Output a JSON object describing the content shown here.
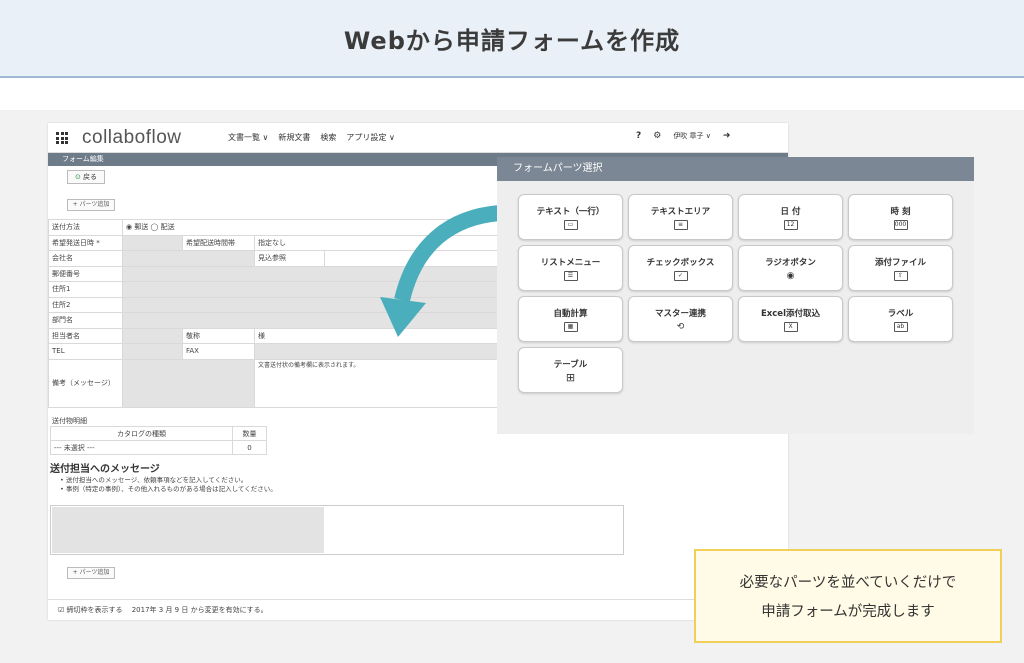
{
  "banner": {
    "title": "Webから申請フォームを作成"
  },
  "app": {
    "logo": "collaboflow",
    "nav": [
      "文書一覧 ∨",
      "新規文書",
      "検索",
      "アプリ設定 ∨"
    ],
    "help": "?",
    "user": "伊吹 章子 ∨",
    "subbar": "フォーム編集",
    "back_button": "戻る",
    "add_parts": "+ パーツ追加",
    "form_rows": [
      {
        "label": "送付方法",
        "value": "◉ 郵送 ◯ 配送"
      },
      {
        "label": "希望発送日時 *",
        "value": "",
        "extra1": "希望配送時間帯",
        "extra2": "指定なし"
      },
      {
        "label": "会社名",
        "value": "",
        "extra1": "見込参照"
      },
      {
        "label": "郵便番号",
        "value": ""
      },
      {
        "label": "住所1",
        "value": ""
      },
      {
        "label": "住所2",
        "value": ""
      },
      {
        "label": "部門名",
        "value": ""
      },
      {
        "label": "担当者名",
        "value": "",
        "extra1": "敬称",
        "extra2": "様"
      },
      {
        "label": "TEL",
        "value": "",
        "extra1": "FAX"
      },
      {
        "label": "備考（メッセージ）",
        "value": "",
        "note": "文書送付状の備考欄に表示されます。"
      }
    ],
    "catalog_section": "送付物明細",
    "catalog_headers": [
      "カタログの種類",
      "数量"
    ],
    "catalog_row": [
      "--- 未選択 ---",
      "0"
    ],
    "message_title": "送付担当へのメッセージ",
    "message_notes": [
      "送付担当へのメッセージ、依頼事項などを記入してください。",
      "事例（特定の事例）、その他入れるものがある場合は記入してください。"
    ],
    "footer": "☑ 締切枠を表示する　 2017年 3 月 9 日 から変更を有効にする。"
  },
  "panel": {
    "title": "フォームパーツ選択",
    "tiles": [
      {
        "label": "テキスト（一行）",
        "icon": "▭"
      },
      {
        "label": "テキストエリア",
        "icon": "≡"
      },
      {
        "label": "日 付",
        "icon": "12"
      },
      {
        "label": "時 刻",
        "icon": "000"
      },
      {
        "label": "リストメニュー",
        "icon": "☰"
      },
      {
        "label": "チェックボックス",
        "icon": "✓"
      },
      {
        "label": "ラジオボタン",
        "icon": "◉"
      },
      {
        "label": "添付ファイル",
        "icon": "⇧"
      },
      {
        "label": "自動計算",
        "icon": "▦"
      },
      {
        "label": "マスター連携",
        "icon": "⟲"
      },
      {
        "label": "Excel添付取込",
        "icon": "X"
      },
      {
        "label": "ラベル",
        "icon": "ab"
      },
      {
        "label": "テーブル",
        "icon": "⊞"
      }
    ]
  },
  "callout": {
    "line1": "必要なパーツを並べていくだけで",
    "line2": "申請フォームが完成します"
  },
  "colors": {
    "arrow": "#4aaebc",
    "callout_border": "#f0d05a",
    "panel_header": "#7b8794"
  }
}
